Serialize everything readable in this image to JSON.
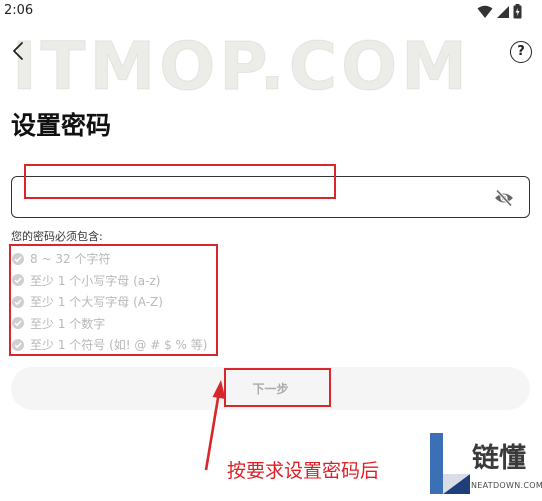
{
  "status_bar": {
    "time": "2:06",
    "icons": [
      "wifi-icon",
      "signal-icon",
      "battery-icon"
    ]
  },
  "watermark": "ITMOP.COM",
  "header": {
    "back_icon": "chevron-left-icon",
    "help_label": "?"
  },
  "title": "设置密码",
  "password": {
    "value": "",
    "placeholder": "",
    "visibility_icon": "eye-off-icon"
  },
  "requirements": {
    "heading": "您的密码必须包含:",
    "items": [
      "8 ~ 32 个字符",
      "至少 1 个小写字母 (a-z)",
      "至少 1 个大写字母 (A-Z)",
      "至少 1 个数字",
      "至少 1 个符号 (如! @ # $ % 等)"
    ]
  },
  "next_button": {
    "label": "下一步"
  },
  "annotation": {
    "caption": "按要求设置密码后",
    "highlight_color": "#d7272c"
  },
  "logo": {
    "cn": "链懂",
    "en": "NEATDOWN.COM"
  },
  "colors": {
    "annotation_red": "#e01e26",
    "disabled_text": "#b8b8b8",
    "button_bg": "#f5f5f5"
  }
}
